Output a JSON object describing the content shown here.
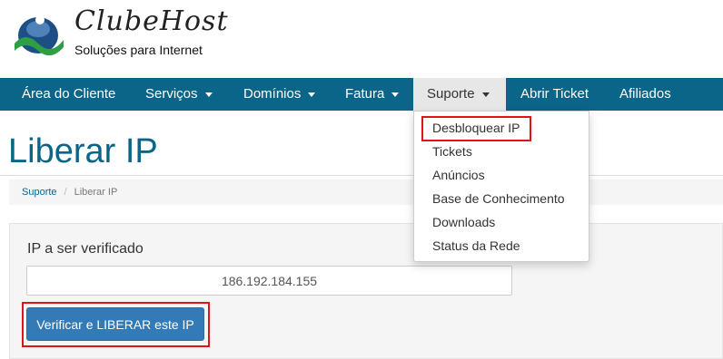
{
  "brand": {
    "name": "ClubeHost",
    "tagline": "Soluções para Internet"
  },
  "colors": {
    "navbar": "#0a6588",
    "accent_red": "#e0121c",
    "primary_button": "#337ab7"
  },
  "nav": {
    "items": [
      {
        "label": "Área do Cliente"
      },
      {
        "label": "Serviços"
      },
      {
        "label": "Domínios"
      },
      {
        "label": "Fatura"
      },
      {
        "label": "Suporte"
      },
      {
        "label": "Abrir Ticket"
      },
      {
        "label": "Afiliados"
      }
    ],
    "active": "Suporte",
    "dropdown": [
      {
        "label": "Desbloquear IP"
      },
      {
        "label": "Tickets"
      },
      {
        "label": "Anúncios"
      },
      {
        "label": "Base de Conhecimento"
      },
      {
        "label": "Downloads"
      },
      {
        "label": "Status da Rede"
      }
    ]
  },
  "page": {
    "title": "Liberar IP"
  },
  "breadcrumb": {
    "parent": "Suporte",
    "separator": "/",
    "current": "Liberar IP"
  },
  "form": {
    "label": "IP a ser verificado",
    "ip_value": "186.192.184.155",
    "button_label": "Verificar e LIBERAR este IP"
  }
}
